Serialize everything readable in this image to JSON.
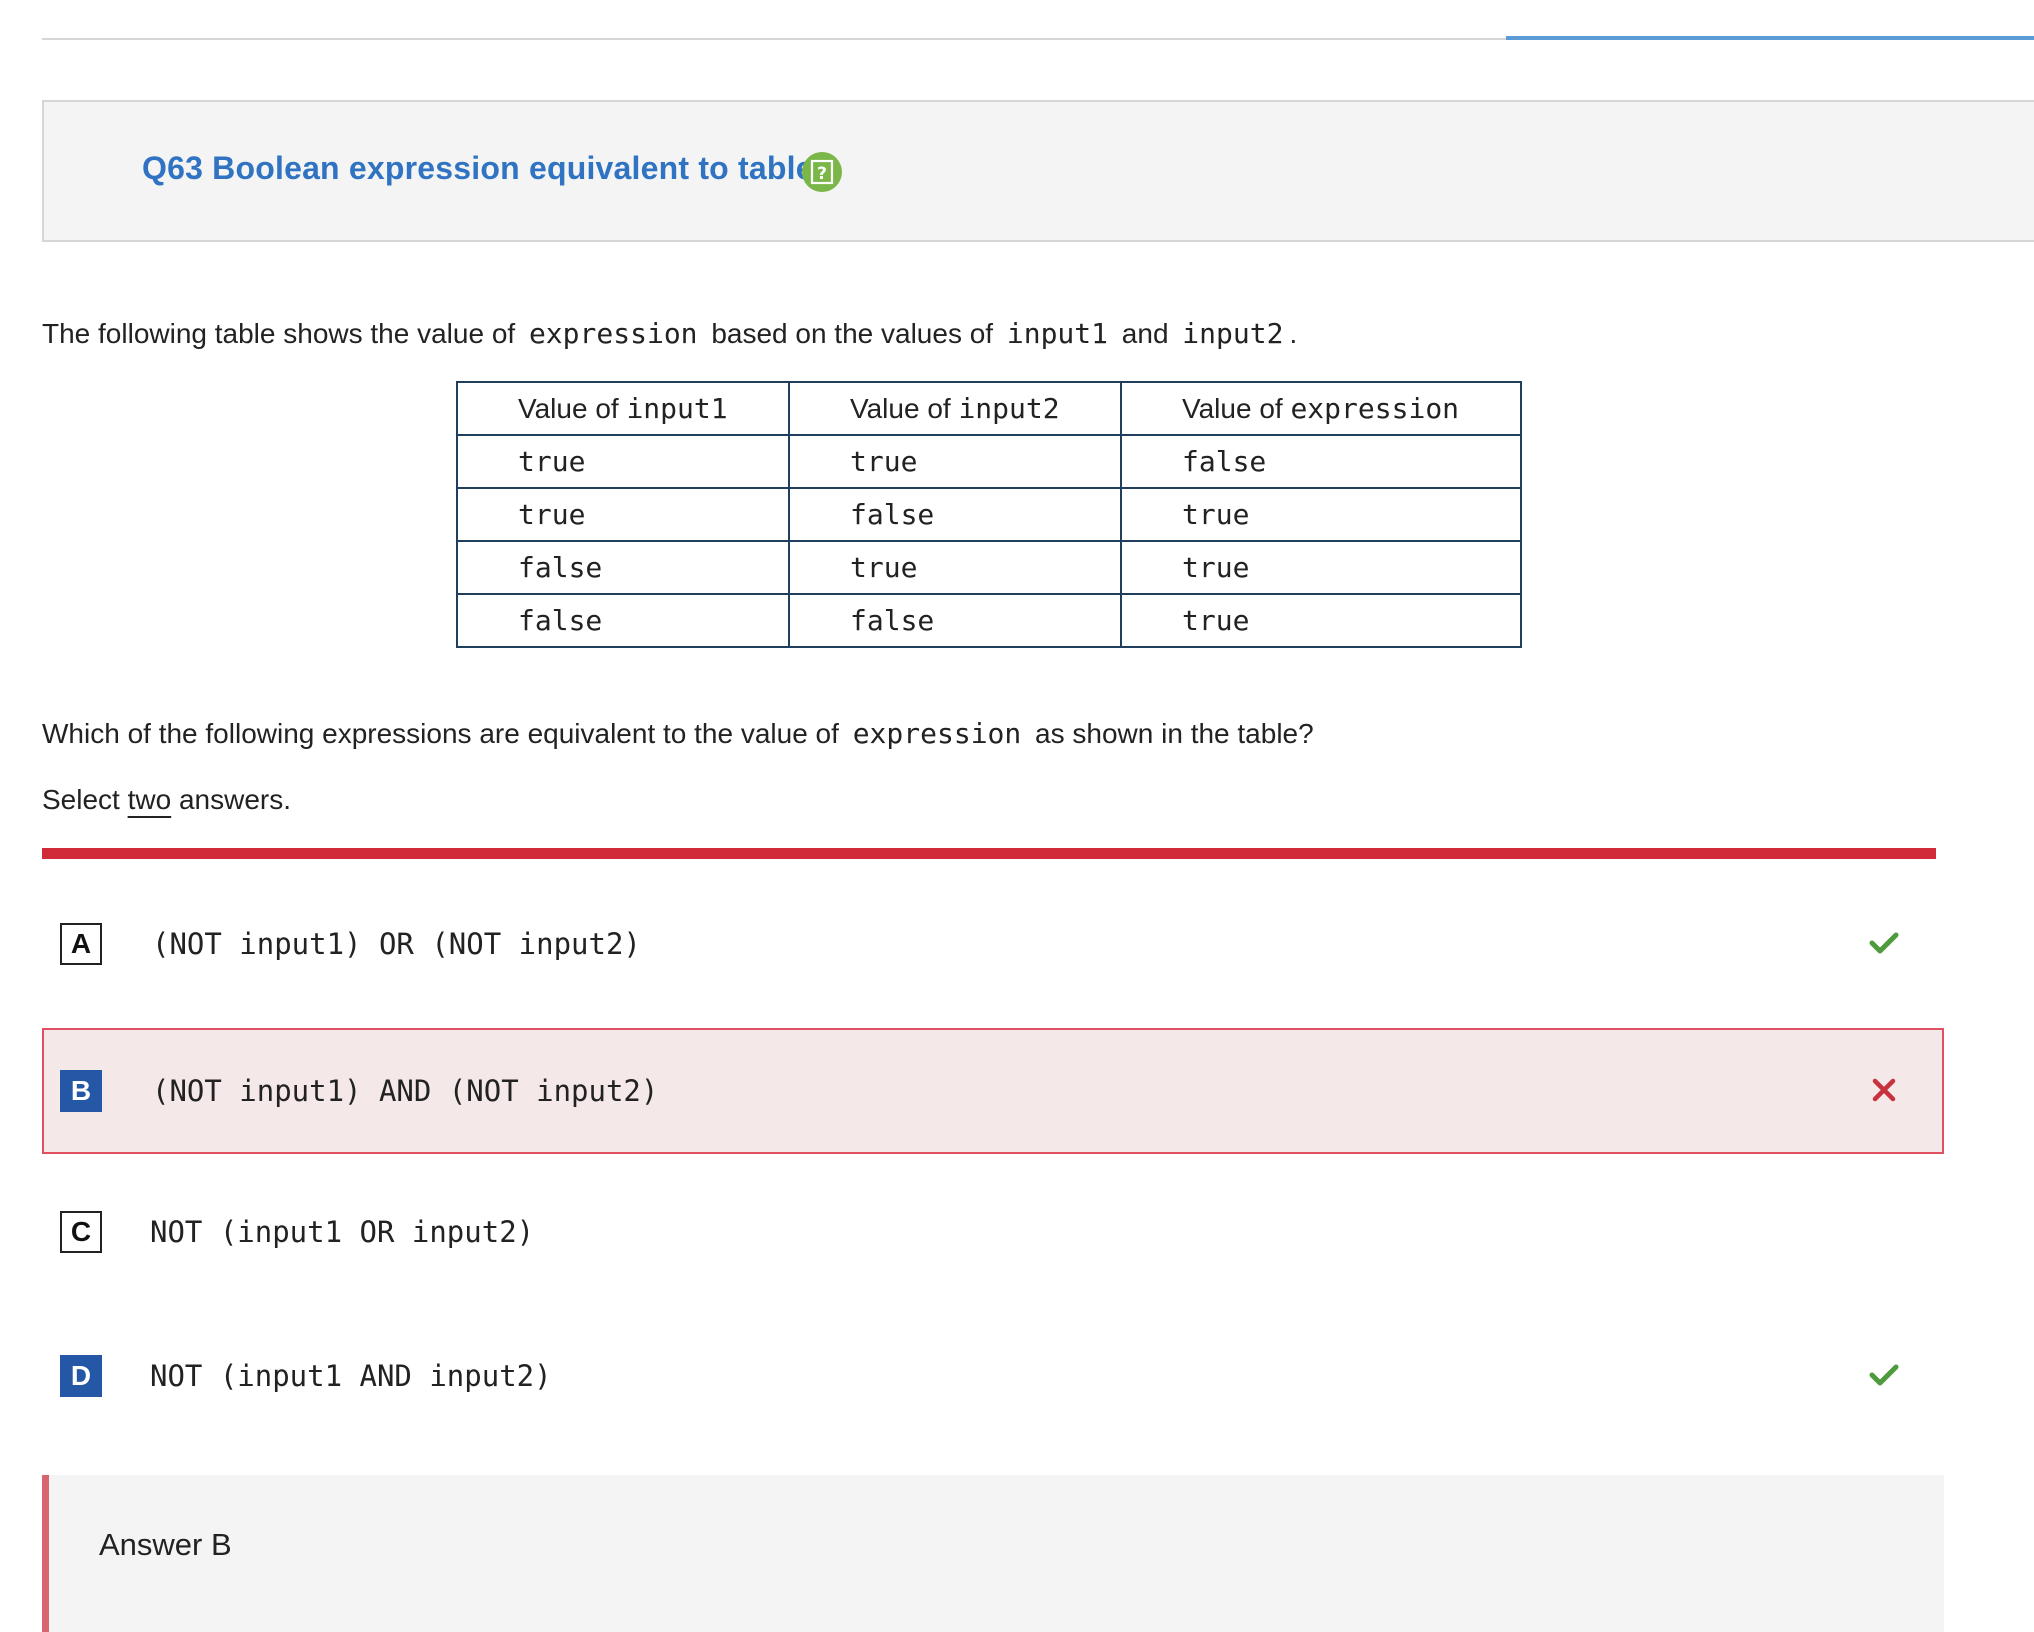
{
  "question": {
    "title": "Q63 Boolean expression equivalent to table",
    "intro_prefix": "The following table shows the value of",
    "intro_code1": "expression",
    "intro_mid": "based on the values of",
    "intro_code2": "input1",
    "intro_and": "and",
    "intro_code3": "input2",
    "intro_end": ".",
    "prompt_prefix": "Which of the following expressions are equivalent to the value of",
    "prompt_code": "expression",
    "prompt_suffix": "as shown in the table?",
    "select_prefix": "Select",
    "select_emph": "two",
    "select_suffix": "answers."
  },
  "table": {
    "headers": [
      {
        "label": "Value of ",
        "code": "input1"
      },
      {
        "label": "Value of ",
        "code": "input2"
      },
      {
        "label": "Value of ",
        "code": "expression"
      }
    ],
    "rows": [
      [
        "true",
        "true",
        "false"
      ],
      [
        "true",
        "false",
        "true"
      ],
      [
        "false",
        "true",
        "true"
      ],
      [
        "false",
        "false",
        "true"
      ]
    ]
  },
  "options": [
    {
      "letter": "A",
      "text": "(NOT input1) OR (NOT input2)",
      "selected": false,
      "mark": "check-icon",
      "status": "correct"
    },
    {
      "letter": "B",
      "text": "(NOT input1) AND (NOT input2)",
      "selected": true,
      "mark": "cross-icon",
      "status": "incorrect"
    },
    {
      "letter": "C",
      "text": "NOT (input1 OR input2)",
      "selected": false,
      "mark": "",
      "status": "none"
    },
    {
      "letter": "D",
      "text": "NOT (input1 AND input2)",
      "selected": true,
      "mark": "check-icon",
      "status": "correct"
    }
  ],
  "answer": {
    "text": "Answer B"
  },
  "colors": {
    "title": "#2f73c2",
    "help_icon": "#7ab648",
    "red_bar": "#d12b39",
    "selected_letter": "#2557a7",
    "correct_mark": "#4e9a3e",
    "incorrect_mark": "#c8323f",
    "wrong_option_bg": "#f5e8e8",
    "answer_border": "#d9636f",
    "progress": "#5b9bd5"
  }
}
